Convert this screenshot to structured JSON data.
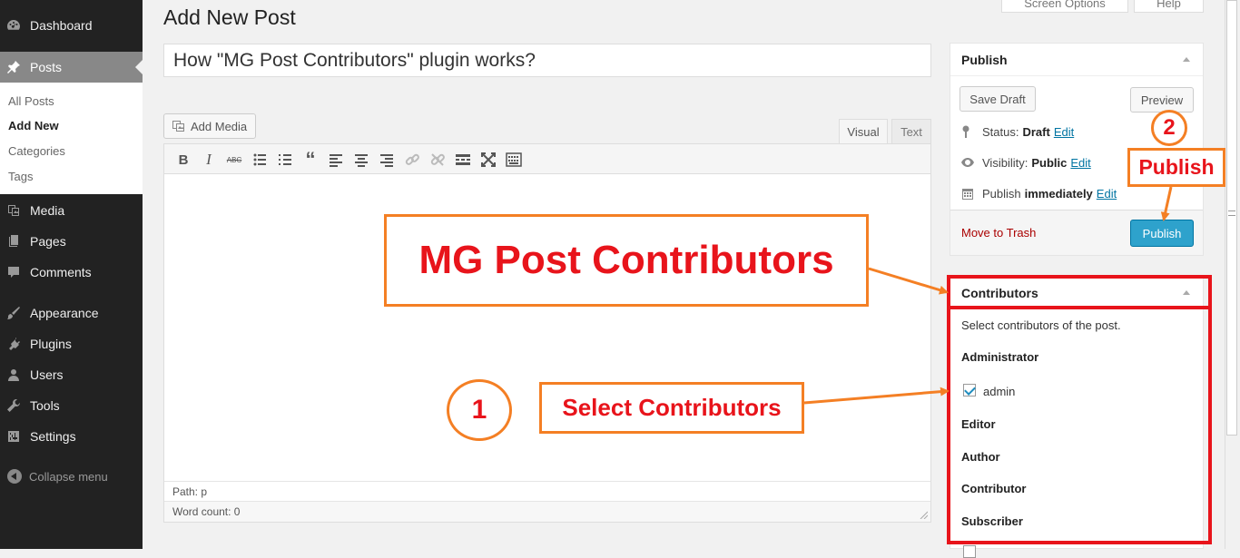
{
  "sidebar": {
    "items": [
      {
        "label": "Dashboard",
        "icon": "dashboard-icon"
      },
      {
        "label": "Posts",
        "icon": "pin-icon"
      },
      {
        "label": "Media",
        "icon": "media-icon"
      },
      {
        "label": "Pages",
        "icon": "pages-icon"
      },
      {
        "label": "Comments",
        "icon": "comment-icon"
      },
      {
        "label": "Appearance",
        "icon": "paintbrush-icon"
      },
      {
        "label": "Plugins",
        "icon": "plug-icon"
      },
      {
        "label": "Users",
        "icon": "user-icon"
      },
      {
        "label": "Tools",
        "icon": "wrench-icon"
      },
      {
        "label": "Settings",
        "icon": "sliders-icon"
      }
    ],
    "submenu": [
      "All Posts",
      "Add New",
      "Categories",
      "Tags"
    ],
    "collapse_label": "Collapse menu"
  },
  "header": {
    "title": "Add New Post",
    "screen_options": "Screen Options",
    "help": "Help"
  },
  "post": {
    "title_value": "How \"MG Post Contributors\" plugin works?"
  },
  "editor": {
    "add_media_label": "Add Media",
    "tab_visual": "Visual",
    "tab_text": "Text",
    "path": "Path: p",
    "word_count": "Word count: 0"
  },
  "publish": {
    "heading": "Publish",
    "save_draft": "Save Draft",
    "preview": "Preview",
    "status_label": "Status:",
    "status_value": "Draft",
    "visibility_label": "Visibility:",
    "visibility_value": "Public",
    "publish_label": "Publish",
    "publish_value": "immediately",
    "edit_link": "Edit",
    "move_to_trash": "Move to Trash",
    "publish_button": "Publish"
  },
  "contributors": {
    "heading": "Contributors",
    "description": "Select contributors of the post.",
    "roles": [
      "Administrator",
      "Editor",
      "Author",
      "Contributor",
      "Subscriber"
    ],
    "admin_user": "admin",
    "admin_checked": true
  },
  "annotations": {
    "main_label": "MG Post Contributors",
    "select_label": "Select Contributors",
    "publish_label": "Publish",
    "step_one": "1",
    "step_two": "2",
    "color_box_border": "#f47f24",
    "color_text": "#e8141b"
  }
}
